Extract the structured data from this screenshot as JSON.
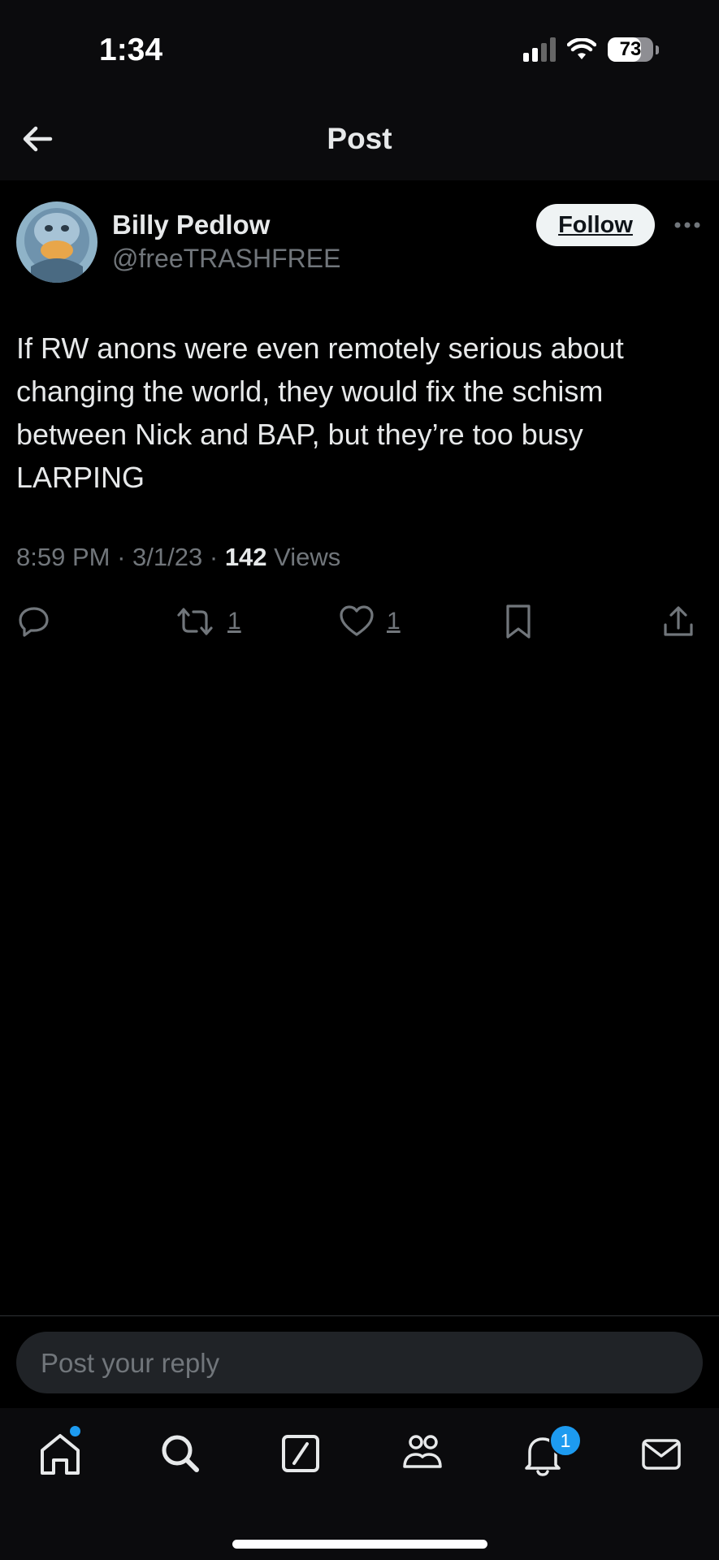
{
  "status_bar": {
    "time": "1:34",
    "battery": "73",
    "battery_level": 0.73,
    "icons": [
      "cellular-signal-icon",
      "wifi-icon",
      "battery-icon"
    ]
  },
  "header": {
    "title": "Post",
    "back_icon": "arrow-left-icon"
  },
  "post": {
    "author_name": "Billy Pedlow",
    "author_handle": "@freeTRASHFREE",
    "follow_label": "Follow",
    "text": "If RW anons were even remotely serious about changing the world, they would fix the schism between Nick and BAP, but they’re too busy LARPING",
    "time": "8:59 PM",
    "date": "3/1/23",
    "separator": "·",
    "views_count": "142",
    "views_label": "Views",
    "reposts": "1",
    "likes": "1",
    "action_icons": [
      "reply-icon",
      "repost-icon",
      "like-icon",
      "bookmark-icon",
      "share-icon"
    ]
  },
  "reply": {
    "placeholder": "Post your reply"
  },
  "tab_bar": {
    "tabs": [
      "home-icon",
      "search-icon",
      "grok-icon",
      "communities-icon",
      "notifications-icon",
      "messages-icon"
    ],
    "notifications_badge": "1"
  },
  "colors": {
    "background": "#000000",
    "text": "#e7e9ea",
    "secondary_text": "#71767b",
    "accent": "#1d9bf0",
    "reply_field": "#202327"
  }
}
